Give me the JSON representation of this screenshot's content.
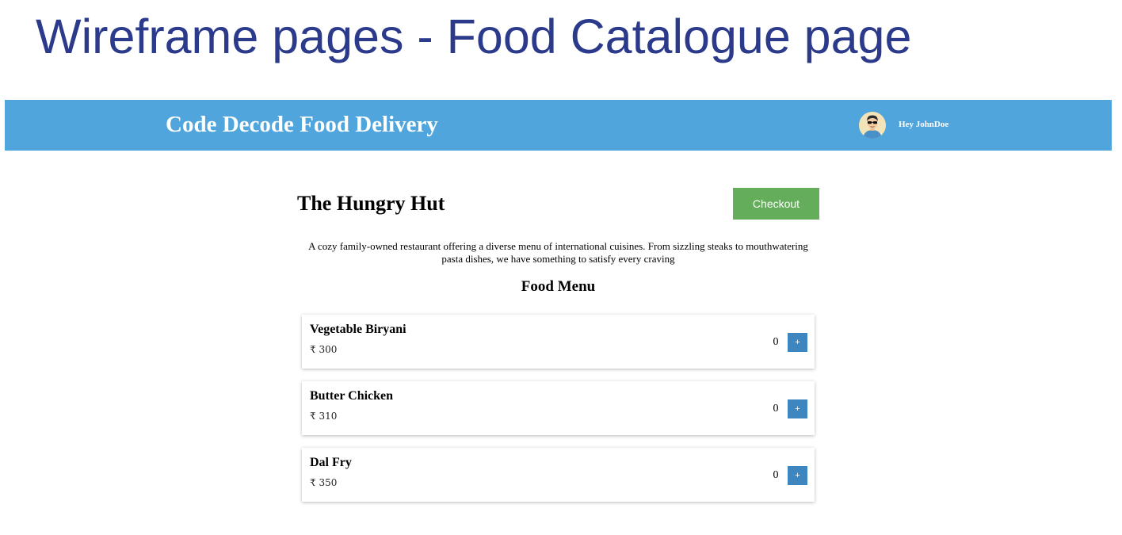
{
  "slide": {
    "title": "Wireframe pages - Food Catalogue page"
  },
  "header": {
    "brand": "Code Decode Food Delivery",
    "greeting": "Hey JohnDoe",
    "background_color": "#4fa5dc",
    "avatar_icon": "user-avatar-icon"
  },
  "restaurant": {
    "name": "The Hungry Hut",
    "description": "A cozy family-owned restaurant offering a diverse menu of international cuisines. From sizzling steaks to mouthwatering pasta dishes, we have something to satisfy every craving"
  },
  "checkout": {
    "label": "Checkout",
    "color": "#64ad5a"
  },
  "menu": {
    "heading": "Food Menu",
    "add_label": "+",
    "add_button_color": "#3d86c0",
    "items": [
      {
        "name": "Vegetable Biryani",
        "price": "₹ 300",
        "quantity": "0"
      },
      {
        "name": "Butter Chicken",
        "price": "₹ 310",
        "quantity": "0"
      },
      {
        "name": "Dal Fry",
        "price": "₹ 350",
        "quantity": "0"
      }
    ]
  }
}
